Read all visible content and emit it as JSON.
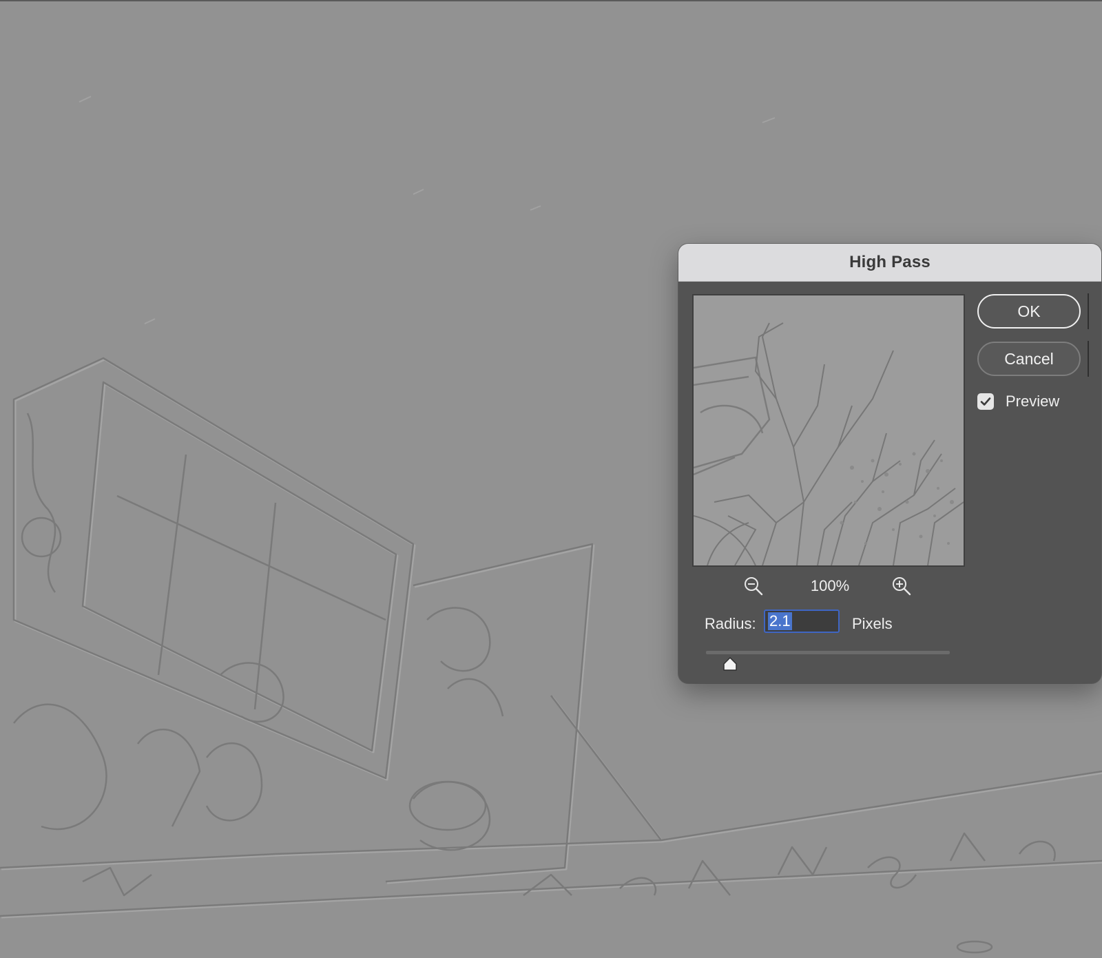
{
  "dialog": {
    "title": "High Pass",
    "ok_label": "OK",
    "cancel_label": "Cancel",
    "preview_label": "Preview",
    "preview_checked": true,
    "zoom_level": "100%",
    "radius_label": "Radius:",
    "radius_value": "2.1",
    "radius_units": "Pixels",
    "slider_fraction": 0.1
  },
  "icons": {
    "zoom_out": "zoom-out-icon",
    "zoom_in": "zoom-in-icon",
    "checkmark": "checkmark-icon"
  },
  "colors": {
    "canvas_gray": "#929292",
    "dialog_bg": "#535353",
    "title_bar": "#dcdcde",
    "focus_accent": "#3f66c4",
    "selection": "#4a75cc"
  }
}
